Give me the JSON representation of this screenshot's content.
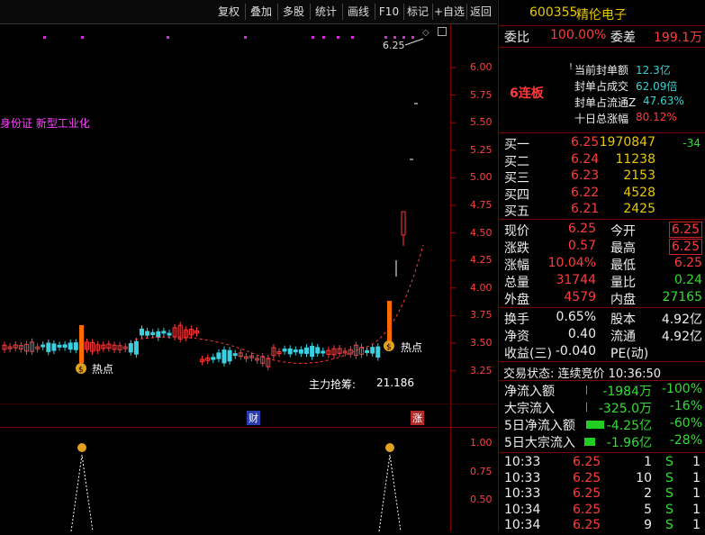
{
  "toolbar": {
    "buttons": [
      "复权",
      "叠加",
      "多股",
      "统计",
      "画线",
      "F10",
      "标记",
      "+自选",
      "返回"
    ]
  },
  "chart": {
    "price_axis": [
      "6.00",
      "5.75",
      "5.50",
      "5.25",
      "5.00",
      "4.75",
      "4.50",
      "4.25",
      "4.00",
      "3.75",
      "3.50",
      "3.25"
    ],
    "indicator_axis": [
      "1.00",
      "0.75",
      "0.50"
    ],
    "concept_label": "身份证 新型工业化",
    "last_price_marker": "6.25",
    "hot_label_left": "热点",
    "hot_label_right": "热点",
    "main_force_label": "主力抢筹:",
    "main_force_value": "21.186",
    "badge_cai": "财",
    "badge_zhang": "涨",
    "money_icon_text": "$"
  },
  "quote": {
    "code": "600355",
    "name": "精伦电子",
    "weibi_label": "委比",
    "weibi_value": "100.00%",
    "weicha_label": "委差",
    "weicha_value": "199.1万",
    "streak": "6连板",
    "seal_amount_label": "当前封单额",
    "seal_amount_value": "12.3亿",
    "seal_deal_label": "封单占成交",
    "seal_deal_value": "62.09倍",
    "seal_float_label": "封单占流通Z",
    "seal_float_value": "47.63%",
    "ten_day_label": "十日总涨幅",
    "ten_day_value": "80.12%",
    "bids": [
      {
        "label": "买一",
        "price": "6.25",
        "vol": "1970847",
        "chg": "-34"
      },
      {
        "label": "买二",
        "price": "6.24",
        "vol": "11238",
        "chg": ""
      },
      {
        "label": "买三",
        "price": "6.23",
        "vol": "2153",
        "chg": ""
      },
      {
        "label": "买四",
        "price": "6.22",
        "vol": "4528",
        "chg": ""
      },
      {
        "label": "买五",
        "price": "6.21",
        "vol": "2425",
        "chg": ""
      }
    ],
    "stats": [
      {
        "l1": "现价",
        "v1": "6.25",
        "l2": "今开",
        "v2": "6.25"
      },
      {
        "l1": "涨跌",
        "v1": "0.57",
        "l2": "最高",
        "v2": "6.25"
      },
      {
        "l1": "涨幅",
        "v1": "10.04%",
        "l2": "最低",
        "v2": "6.25"
      },
      {
        "l1": "总量",
        "v1": "31744",
        "l2": "量比",
        "v2": "0.24"
      },
      {
        "l1": "外盘",
        "v1": "4579",
        "l2": "内盘",
        "v2": "27165"
      }
    ],
    "stats2": [
      {
        "l1": "换手",
        "v1": "0.65%",
        "l2": "股本",
        "v2": "4.92亿"
      },
      {
        "l1": "净资",
        "v1": "0.40",
        "l2": "流通",
        "v2": "4.92亿"
      },
      {
        "l1": "收益(三)",
        "v1": "-0.040",
        "l2": "PE(动)",
        "v2": ""
      }
    ],
    "trade_status": "交易状态: 连续竞价 10:36:50",
    "flows": [
      {
        "label": "净流入额",
        "v1": "-1984万",
        "v2": "-100%"
      },
      {
        "label": "大宗流入",
        "v1": "-325.0万",
        "v2": "-16%"
      },
      {
        "label": "5日净流入额",
        "v1": "-4.25亿",
        "v2": "-60%"
      },
      {
        "label": "5日大宗流入",
        "v1": "-1.96亿",
        "v2": "-28%"
      }
    ],
    "ticks": [
      {
        "time": "10:33",
        "price": "6.25",
        "vol": "1",
        "side": "S",
        "n": "1"
      },
      {
        "time": "10:33",
        "price": "6.25",
        "vol": "10",
        "side": "S",
        "n": "1"
      },
      {
        "time": "10:33",
        "price": "6.25",
        "vol": "2",
        "side": "S",
        "n": "1"
      },
      {
        "time": "10:34",
        "price": "6.25",
        "vol": "5",
        "side": "S",
        "n": "1"
      },
      {
        "time": "10:34",
        "price": "6.25",
        "vol": "9",
        "side": "S",
        "n": "1"
      }
    ]
  }
}
